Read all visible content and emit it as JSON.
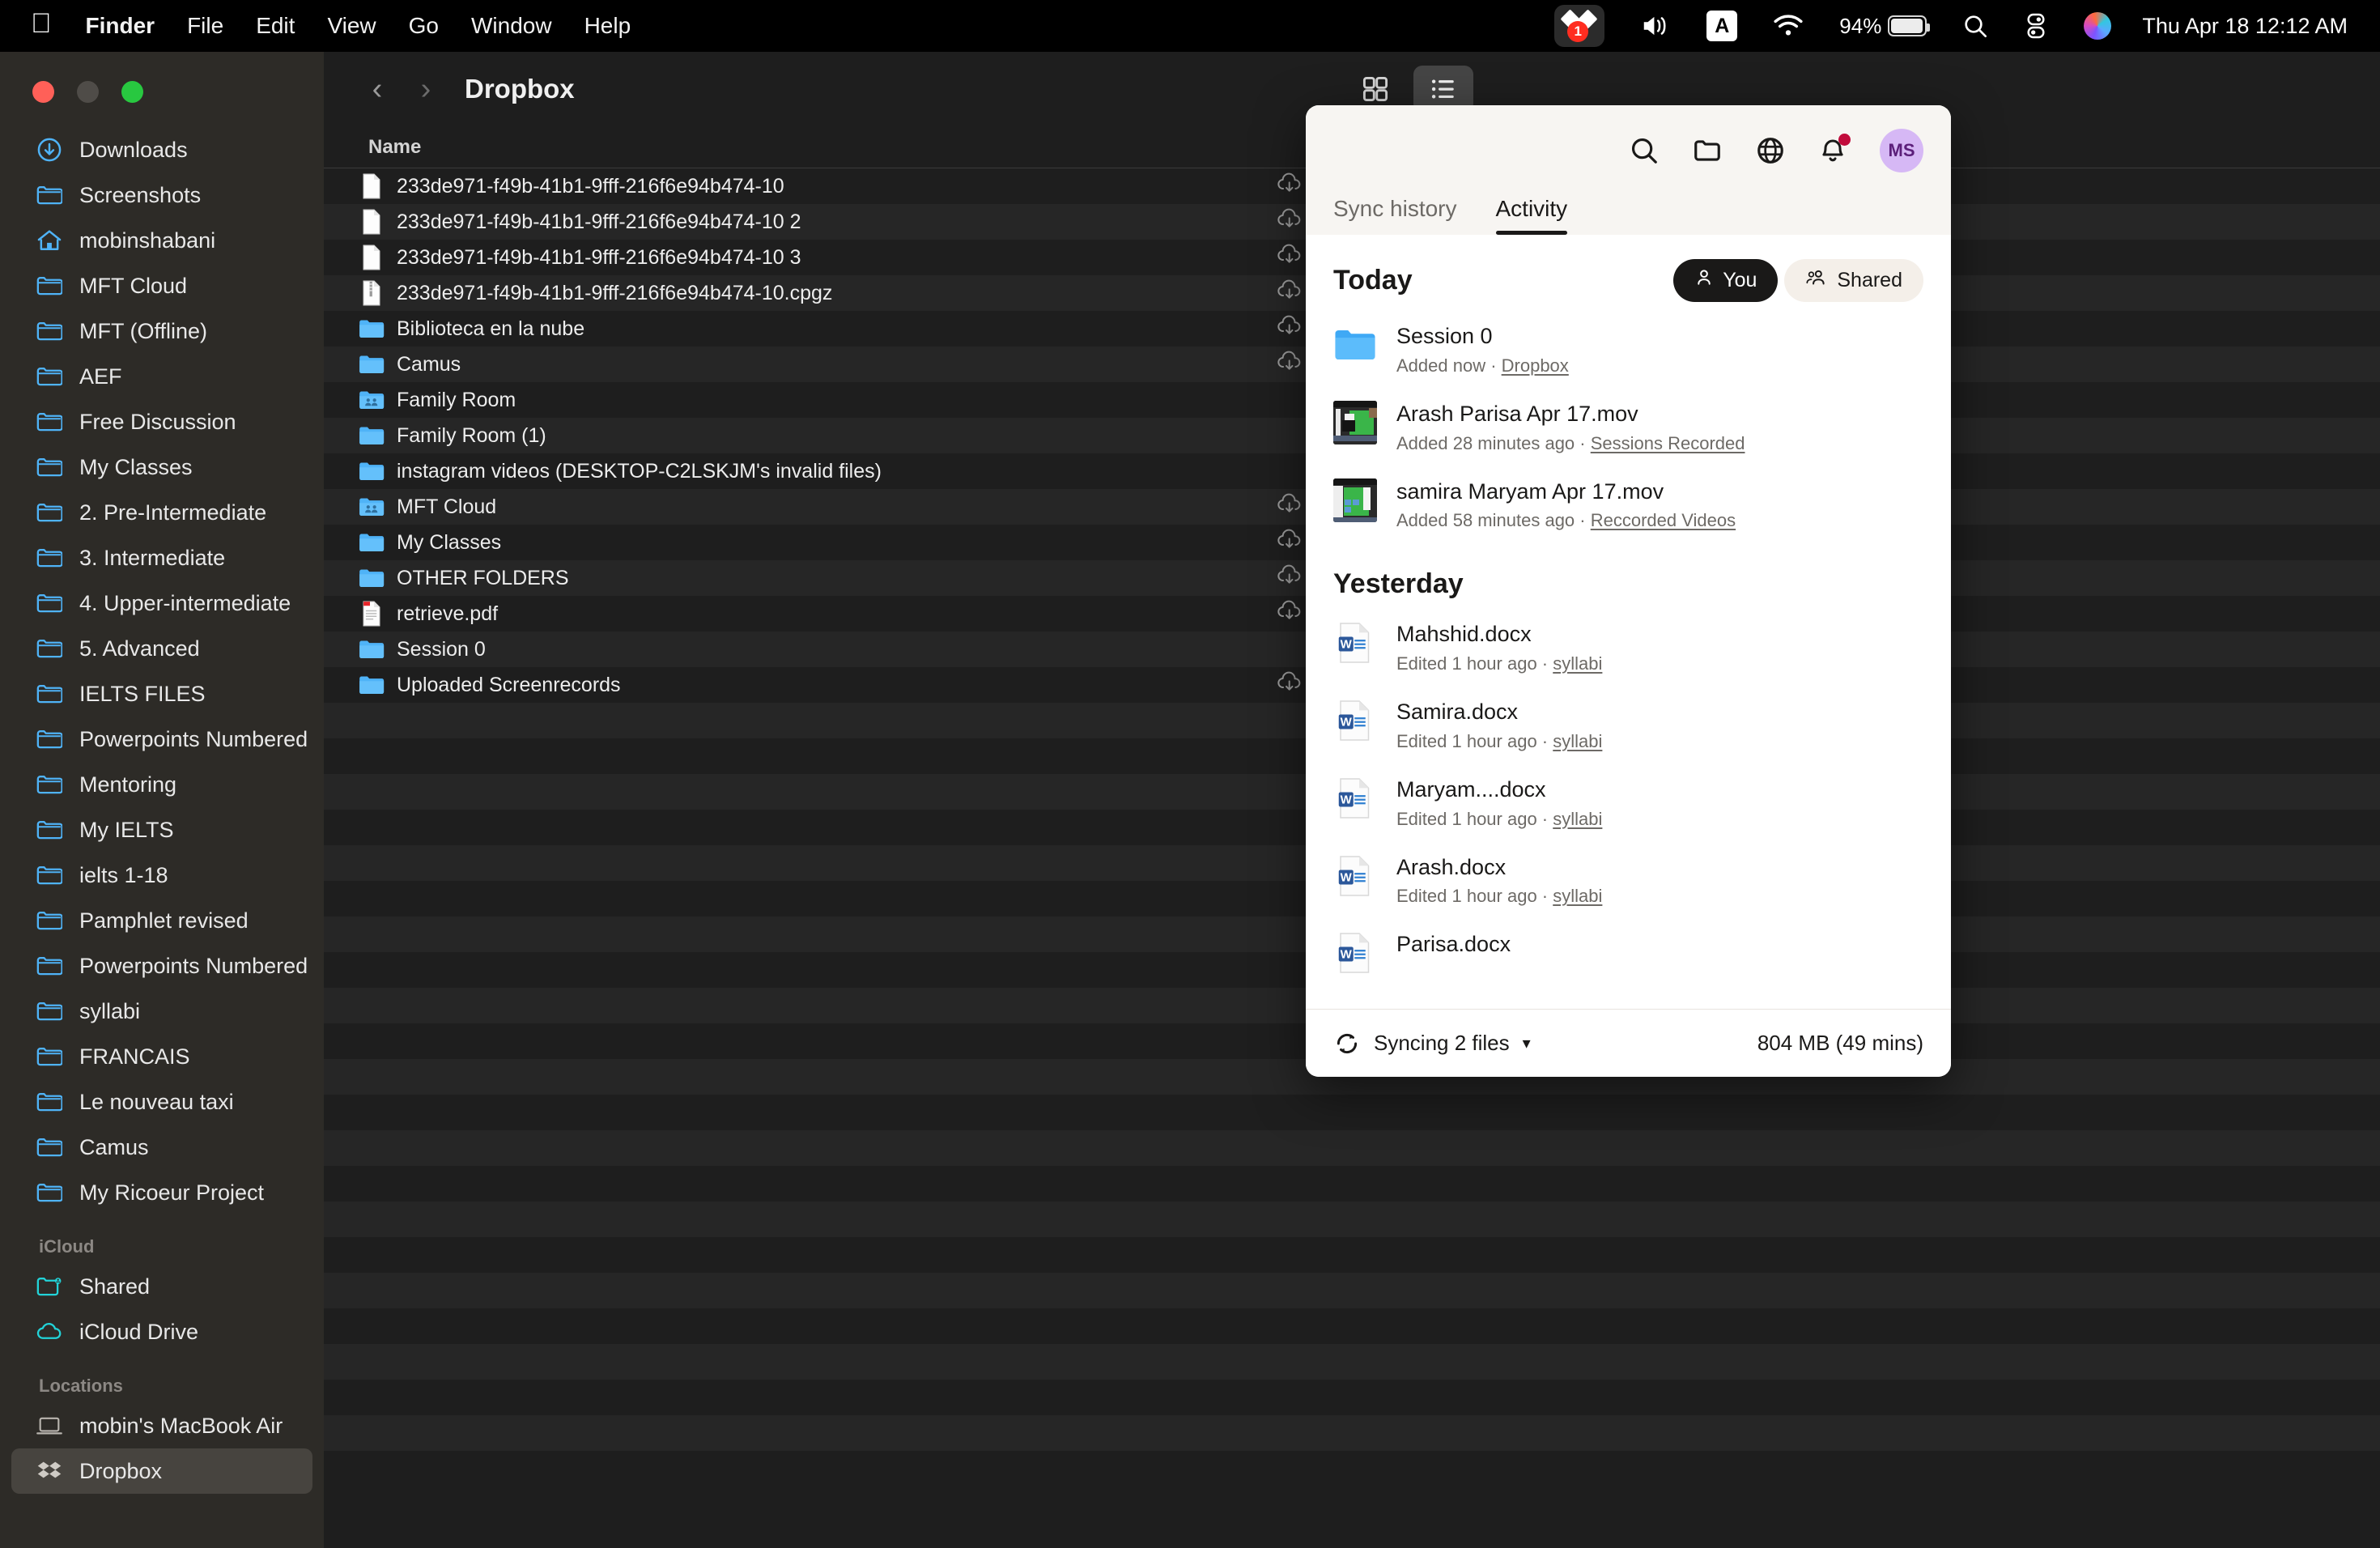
{
  "menubar": {
    "apple": "apple-logo",
    "items": [
      "Finder",
      "File",
      "Edit",
      "View",
      "Go",
      "Window",
      "Help"
    ],
    "dropbox_badge": "1",
    "input_source": "A",
    "battery_percent": "94%",
    "clock": "Thu Apr 18  12:12 AM"
  },
  "finder": {
    "title": "Dropbox",
    "column_header_name": "Name",
    "rows": [
      {
        "name": "233de971-f49b-41b1-9fff-216f6e94b474-10",
        "kind": "file",
        "cloud": true
      },
      {
        "name": "233de971-f49b-41b1-9fff-216f6e94b474-10 2",
        "kind": "file",
        "cloud": true
      },
      {
        "name": "233de971-f49b-41b1-9fff-216f6e94b474-10 3",
        "kind": "file",
        "cloud": true
      },
      {
        "name": "233de971-f49b-41b1-9fff-216f6e94b474-10.cpgz",
        "kind": "archive",
        "cloud": true
      },
      {
        "name": "Biblioteca en la nube",
        "kind": "folder",
        "cloud": true
      },
      {
        "name": "Camus",
        "kind": "folder",
        "cloud": true
      },
      {
        "name": "Family Room",
        "kind": "shared-folder",
        "cloud": false
      },
      {
        "name": "Family Room (1)",
        "kind": "folder",
        "cloud": false
      },
      {
        "name": "instagram videos (DESKTOP-C2LSKJM's invalid files)",
        "kind": "folder",
        "cloud": false
      },
      {
        "name": "MFT Cloud",
        "kind": "shared-folder",
        "cloud": true
      },
      {
        "name": "My Classes",
        "kind": "folder",
        "cloud": true
      },
      {
        "name": "OTHER FOLDERS",
        "kind": "folder",
        "cloud": true
      },
      {
        "name": "retrieve.pdf",
        "kind": "pdf",
        "cloud": true
      },
      {
        "name": "Session 0",
        "kind": "folder",
        "cloud": false
      },
      {
        "name": "Uploaded Screenrecords",
        "kind": "folder",
        "cloud": true
      }
    ]
  },
  "sidebar": {
    "favorites": [
      {
        "label": "Downloads",
        "icon": "downloads-icon"
      },
      {
        "label": "Screenshots",
        "icon": "folder-icon"
      },
      {
        "label": "mobinshabani",
        "icon": "home-icon"
      },
      {
        "label": "MFT Cloud",
        "icon": "folder-icon"
      },
      {
        "label": "MFT (Offline)",
        "icon": "folder-icon"
      },
      {
        "label": "AEF",
        "icon": "folder-icon"
      },
      {
        "label": "Free Discussion",
        "icon": "folder-icon"
      },
      {
        "label": "My Classes",
        "icon": "folder-icon"
      },
      {
        "label": "2. Pre-Intermediate",
        "icon": "folder-icon"
      },
      {
        "label": "3. Intermediate",
        "icon": "folder-icon"
      },
      {
        "label": "4. Upper-intermediate",
        "icon": "folder-icon"
      },
      {
        "label": "5. Advanced",
        "icon": "folder-icon"
      },
      {
        "label": "IELTS FILES",
        "icon": "folder-icon"
      },
      {
        "label": "Powerpoints Numbered",
        "icon": "folder-icon"
      },
      {
        "label": "Mentoring",
        "icon": "folder-icon"
      },
      {
        "label": "My IELTS",
        "icon": "folder-icon"
      },
      {
        "label": "ielts 1-18",
        "icon": "folder-icon"
      },
      {
        "label": "Pamphlet revised",
        "icon": "folder-icon"
      },
      {
        "label": "Powerpoints Numbered",
        "icon": "folder-icon"
      },
      {
        "label": "syllabi",
        "icon": "folder-icon"
      },
      {
        "label": "FRANCAIS",
        "icon": "folder-icon"
      },
      {
        "label": "Le nouveau taxi",
        "icon": "folder-icon"
      },
      {
        "label": "Camus",
        "icon": "folder-icon"
      },
      {
        "label": "My Ricoeur Project",
        "icon": "folder-icon"
      }
    ],
    "icloud_header": "iCloud",
    "icloud": [
      {
        "label": "Shared",
        "icon": "shared-folder-icon"
      },
      {
        "label": "iCloud Drive",
        "icon": "cloud-icon"
      }
    ],
    "locations_header": "Locations",
    "locations": [
      {
        "label": "mobin's MacBook Air",
        "icon": "laptop-icon",
        "selected": false
      },
      {
        "label": "Dropbox",
        "icon": "dropbox-icon",
        "selected": true
      }
    ]
  },
  "dropbox_panel": {
    "avatar_initials": "MS",
    "tabs": [
      {
        "label": "Sync history",
        "active": false
      },
      {
        "label": "Activity",
        "active": true
      }
    ],
    "sections": [
      {
        "title": "Today",
        "filters": [
          {
            "label": "You",
            "active": true,
            "icon": "person-icon"
          },
          {
            "label": "Shared",
            "active": false,
            "icon": "people-icon"
          }
        ],
        "items": [
          {
            "name": "Session 0",
            "meta_prefix": "Added now · ",
            "meta_link": "Dropbox",
            "icon": "folder-icon"
          },
          {
            "name": "Arash Parisa Apr 17.mov",
            "meta_prefix": "Added 28 minutes ago · ",
            "meta_link": "Sessions Recorded",
            "icon": "video-thumb"
          },
          {
            "name": "samira Maryam Apr 17.mov",
            "meta_prefix": "Added 58 minutes ago · ",
            "meta_link": "Reccorded Videos",
            "icon": "video-thumb"
          }
        ]
      },
      {
        "title": "Yesterday",
        "filters": [],
        "items": [
          {
            "name": "Mahshid.docx",
            "meta_prefix": "Edited 1 hour ago · ",
            "meta_link": "syllabi",
            "icon": "word-icon"
          },
          {
            "name": "Samira.docx",
            "meta_prefix": "Edited 1 hour ago · ",
            "meta_link": "syllabi",
            "icon": "word-icon"
          },
          {
            "name": "Maryam....docx",
            "meta_prefix": "Edited 1 hour ago · ",
            "meta_link": "syllabi",
            "icon": "word-icon"
          },
          {
            "name": "Arash.docx",
            "meta_prefix": "Edited 1 hour ago · ",
            "meta_link": "syllabi",
            "icon": "word-icon"
          },
          {
            "name": "Parisa.docx",
            "meta_prefix": "",
            "meta_link": "",
            "icon": "word-icon"
          }
        ]
      }
    ],
    "footer": {
      "sync_status": "Syncing 2 files",
      "transfer": "804 MB (49 mins)"
    }
  },
  "colors": {
    "accent_blue": "#0a84ff",
    "folder_blue": "#4fb3f7",
    "sidebar_bg": "#2d2b27",
    "panel_bg": "#ffffff",
    "pill_active": "#1a1918",
    "avatar_bg": "#d6b8f5",
    "badge_red": "#ff2d20",
    "word_blue": "#2b579a"
  }
}
